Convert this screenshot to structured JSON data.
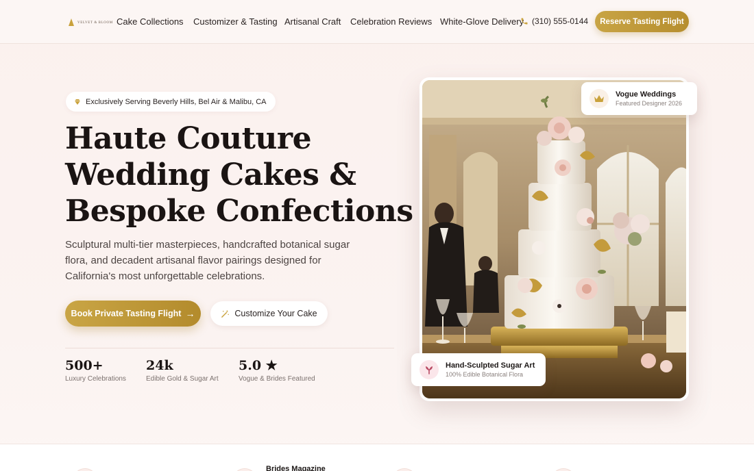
{
  "nav": {
    "brand": "VELVET & BLOOM",
    "links": [
      "Cake Collections",
      "Customizer & Tasting",
      "Artisanal Craft",
      "Celebration Reviews",
      "White-Glove Delivery"
    ],
    "phone": "(310) 555-0144",
    "cta": "Reserve Tasting Flight"
  },
  "hero": {
    "pill": "Exclusively Serving Beverly Hills, Bel Air & Malibu, CA",
    "headline": [
      "Haute Couture",
      "Wedding Cakes &",
      "Bespoke Confections"
    ],
    "subtext": "Sculptural multi-tier masterpieces, handcrafted botanical sugar flora, and decadent artisanal flavor pairings designed for California's most unforgettable celebrations.",
    "primary_cta": "Book Private Tasting Flight",
    "secondary_cta": "Customize Your Cake",
    "stats": [
      {
        "value": "500+",
        "label": "Luxury Celebrations"
      },
      {
        "value": "24k",
        "label": "Edible Gold & Sugar Art"
      },
      {
        "value": "5.0 ★",
        "label": "Vogue & Brides Featured"
      }
    ]
  },
  "badges": {
    "top": {
      "title": "Vogue Weddings",
      "subtitle": "Featured Designer 2026"
    },
    "bottom": {
      "title": "Hand-Sculpted Sugar Art",
      "subtitle": "100% Edible Botanical Flora"
    }
  },
  "strip": {
    "visible_text": "Brides Magazine"
  },
  "colors": {
    "gold": "#c8a445",
    "background": "#fbf1ee",
    "text": "#1a1413"
  }
}
